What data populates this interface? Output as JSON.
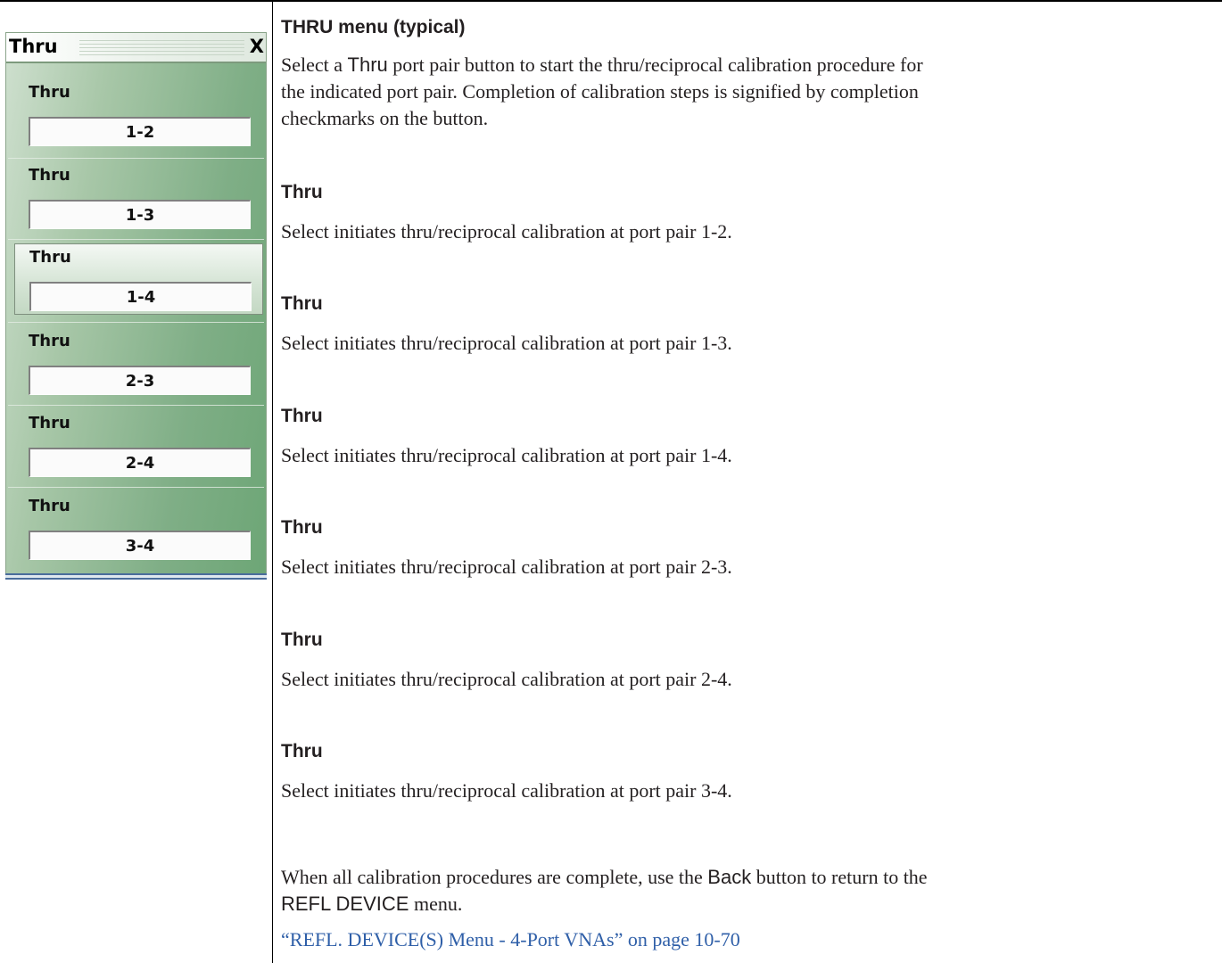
{
  "menu": {
    "title": "Thru",
    "close_label": "X",
    "items": [
      {
        "label": "Thru",
        "value": "1-2",
        "selected": false
      },
      {
        "label": "Thru",
        "value": "1-3",
        "selected": false
      },
      {
        "label": "Thru",
        "value": "1-4",
        "selected": true
      },
      {
        "label": "Thru",
        "value": "2-3",
        "selected": false
      },
      {
        "label": "Thru",
        "value": "2-4",
        "selected": false
      },
      {
        "label": "Thru",
        "value": "3-4",
        "selected": false
      }
    ]
  },
  "doc": {
    "heading": "THRU menu (typical)",
    "intro": {
      "pre": "Select a ",
      "term": "Thru",
      "post1": " port pair button to start the thru/reciprocal calibration procedure for",
      "line2": "the indicated port pair. Completion of calibration steps is signified by completion",
      "line3": "checkmarks on the button."
    },
    "entries": [
      {
        "title": "Thru",
        "text": "Select initiates thru/reciprocal calibration at port pair 1-2."
      },
      {
        "title": "Thru",
        "text": "Select initiates thru/reciprocal calibration at port pair 1-3."
      },
      {
        "title": "Thru",
        "text": "Select initiates thru/reciprocal calibration at port pair 1-4."
      },
      {
        "title": "Thru",
        "text": "Select initiates thru/reciprocal calibration at port pair 2-3."
      },
      {
        "title": "Thru",
        "text": "Select initiates thru/reciprocal calibration at port pair 2-4."
      },
      {
        "title": "Thru",
        "text": "Select initiates thru/reciprocal calibration at port pair 3-4."
      }
    ],
    "closing": {
      "pre": "When all calibration procedures are complete, use the ",
      "button": "Back",
      "post": " button to return to the",
      "menu_name": "REFL DEVICE",
      "menu_suffix": " menu."
    },
    "link": "“REFL. DEVICE(S) Menu - 4-Port VNAs” on page 10-70"
  }
}
